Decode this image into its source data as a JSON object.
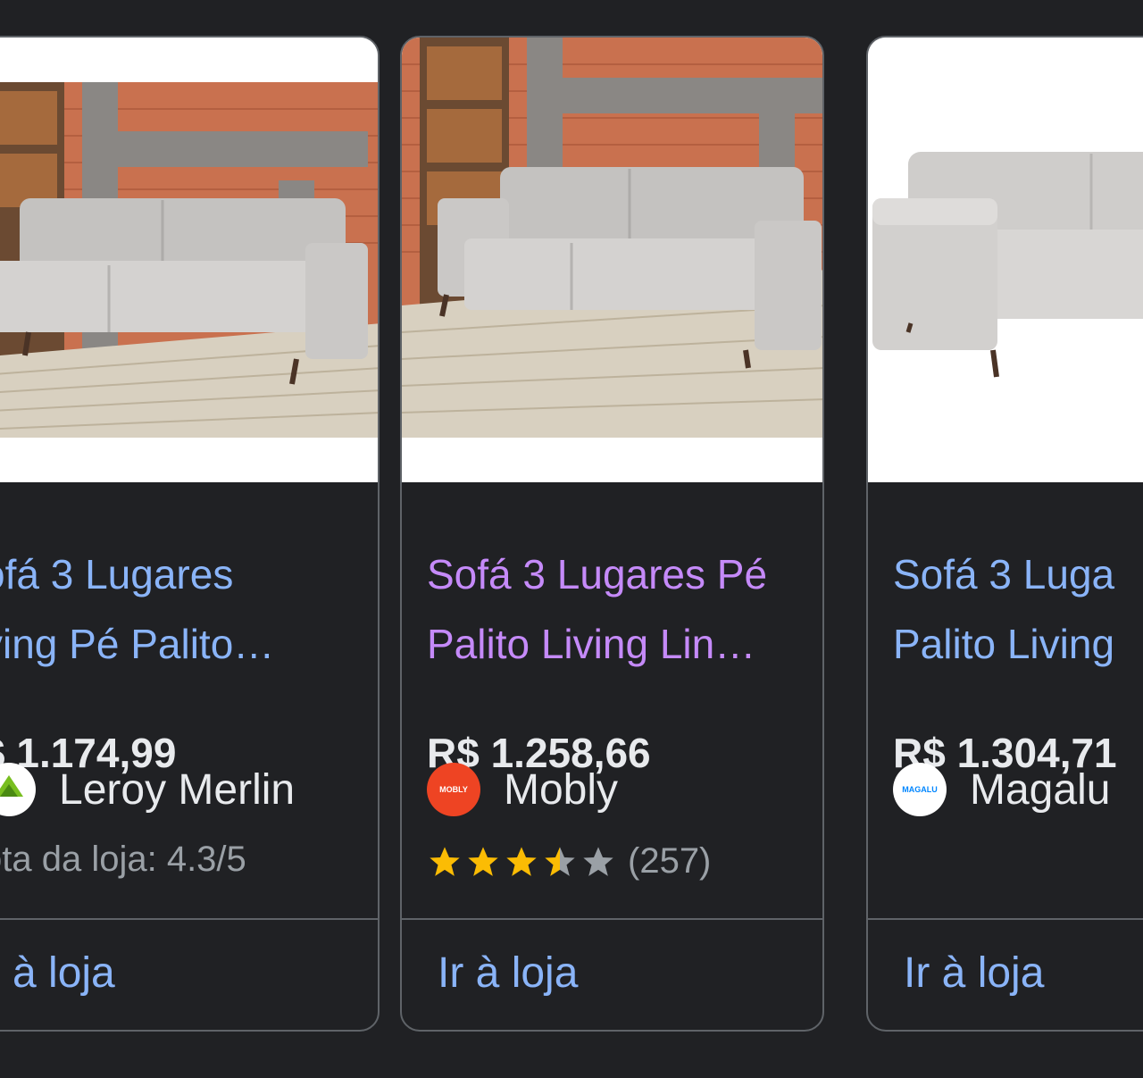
{
  "colors": {
    "background": "#202124",
    "card_border": "#5f6368",
    "visited_link": "#c58af9",
    "link": "#8ab4f8",
    "text_primary": "#e8eaed",
    "text_secondary": "#9aa0a6",
    "star_filled": "#fbbc04",
    "star_empty": "#9aa0a6"
  },
  "products": [
    {
      "title_line1": "ofá 3 Lugares",
      "title_line2": "ving Pé Palito…",
      "price": "$ 1.174,99",
      "store": "Leroy Merlin",
      "store_icon": "leroy-merlin-logo",
      "store_rating": "ota da loja: 4.3/5",
      "cta": "à loja"
    },
    {
      "title_line1": "Sofá 3 Lugares Pé",
      "title_line2": "Palito Living Lin…",
      "price": "R$ 1.258,66",
      "store": "Mobly",
      "store_icon": "mobly-logo",
      "store_logo_text": "MOBLY",
      "rating": 3.5,
      "review_count": "(257)",
      "cta": "Ir à loja"
    },
    {
      "title_line1": "Sofá 3 Luga",
      "title_line2": "Palito Living",
      "price": "R$ 1.304,71",
      "store": "Magalu",
      "store_icon": "magalu-logo",
      "store_logo_text": "MAGALU",
      "cta": "Ir à loja"
    }
  ]
}
